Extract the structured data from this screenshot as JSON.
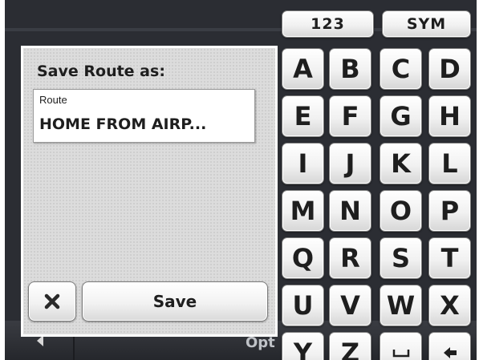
{
  "dialog": {
    "title": "Save Route as:",
    "field_label": "Route",
    "field_value": "HOME FROM AIRP...",
    "cancel_icon": "close-icon",
    "save_label": "Save"
  },
  "keyboard": {
    "mode_buttons": [
      "123",
      "SYM"
    ],
    "keys": [
      "A",
      "B",
      "C",
      "D",
      "E",
      "F",
      "G",
      "H",
      "I",
      "J",
      "K",
      "L",
      "M",
      "N",
      "O",
      "P",
      "Q",
      "R",
      "S",
      "T",
      "U",
      "V",
      "W",
      "X",
      "Y",
      "Z"
    ],
    "space_icon": "space-icon",
    "backspace_icon": "backspace-icon"
  },
  "background": {
    "options_partial": "Opt",
    "back_icon": "back-arrow-icon"
  }
}
